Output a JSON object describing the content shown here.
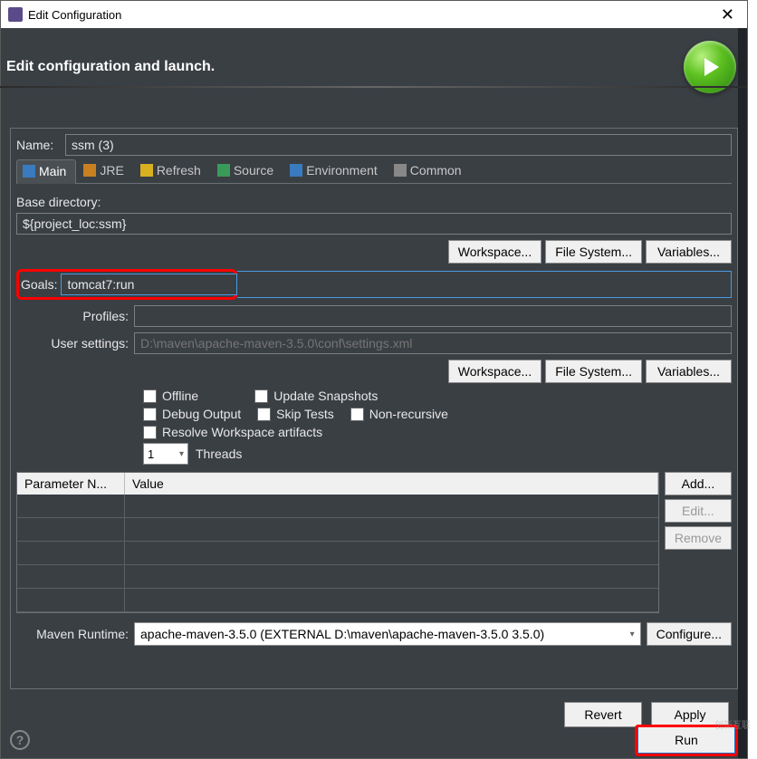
{
  "window": {
    "title": "Edit Configuration"
  },
  "header": {
    "title": "Edit configuration and launch."
  },
  "form": {
    "name_label": "Name:",
    "name_value": "ssm (3)",
    "base_dir_label": "Base directory:",
    "base_dir_value": "${project_loc:ssm}",
    "goals_label": "Goals:",
    "goals_value": "tomcat7:run",
    "profiles_label": "Profiles:",
    "profiles_value": "",
    "user_settings_label": "User settings:",
    "user_settings_placeholder": "D:\\maven\\apache-maven-3.5.0\\conf\\settings.xml",
    "threads_label": "Threads",
    "threads_value": "1",
    "maven_runtime_label": "Maven Runtime:",
    "maven_runtime_value": "apache-maven-3.5.0 (EXTERNAL D:\\maven\\apache-maven-3.5.0 3.5.0)"
  },
  "tabs": {
    "main": "Main",
    "jre": "JRE",
    "refresh": "Refresh",
    "source": "Source",
    "environment": "Environment",
    "common": "Common"
  },
  "buttons": {
    "workspace": "Workspace...",
    "filesystem": "File System...",
    "variables": "Variables...",
    "add": "Add...",
    "edit": "Edit...",
    "remove": "Remove",
    "configure": "Configure...",
    "revert": "Revert",
    "apply": "Apply",
    "run": "Run"
  },
  "checks": {
    "offline": "Offline",
    "update_snapshots": "Update Snapshots",
    "debug_output": "Debug Output",
    "skip_tests": "Skip Tests",
    "non_recursive": "Non-recursive",
    "resolve_workspace": "Resolve Workspace artifacts"
  },
  "table": {
    "col_param": "Parameter N...",
    "col_value": "Value"
  },
  "watermark": "创新互联"
}
